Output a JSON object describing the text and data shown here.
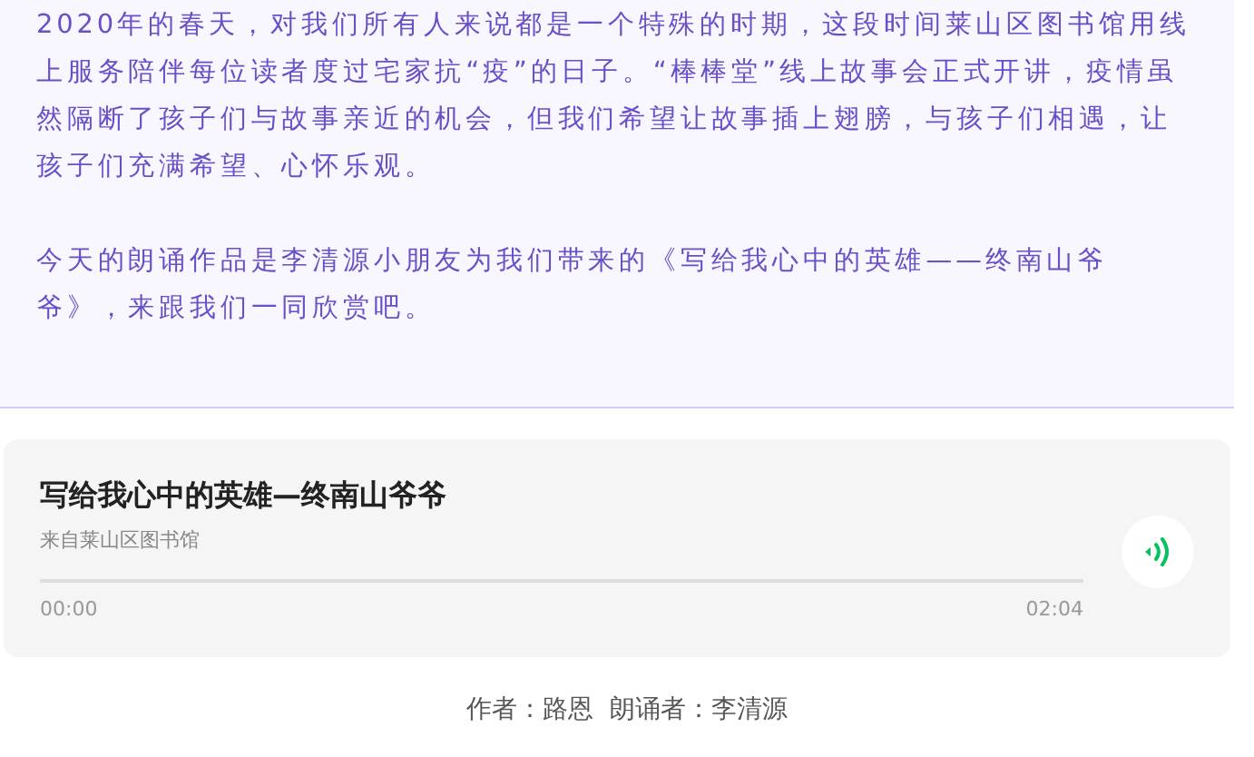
{
  "intro": {
    "paragraphs": [
      "2020年的春天，对我们所有人来说都是一个特殊的时期，这段时间莱山区图书馆用线上服务陪伴每位读者度过宅家抗“疫”的日子。“棒棒堂”线上故事会正式开讲，疫情虽然隔断了孩子们与故事亲近的机会，但我们希望让故事插上翅膀，与孩子们相遇，让孩子们充满希望、心怀乐观。",
      "今天的朗诵作品是李清源小朋友为我们带来的《写给我心中的英雄——终南山爷爷》，来跟我们一同欣赏吧。"
    ]
  },
  "audio": {
    "title": "写给我心中的英雄—终南山爷爷",
    "source": "来自莱山区图书馆",
    "level": 0,
    "current_time": "00:00",
    "duration": "02:04"
  },
  "credits": "作者：路恩  朗诵者：李清源"
}
